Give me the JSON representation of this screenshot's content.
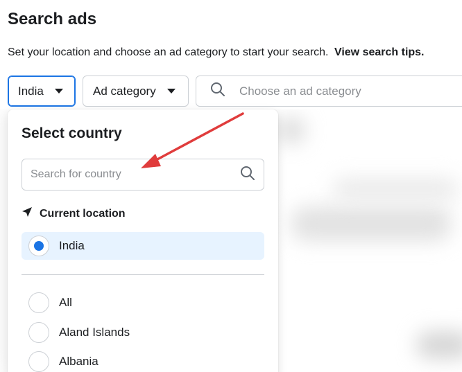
{
  "header": {
    "title": "Search ads",
    "subtitle": "Set your location and choose an ad category to start your search.",
    "tips_link": "View search tips."
  },
  "toolbar": {
    "country_label": "India",
    "category_label": "Ad category",
    "search_placeholder": "Choose an ad category"
  },
  "dropdown": {
    "title": "Select country",
    "search_placeholder": "Search for country",
    "current_location_label": "Current location",
    "selected_country": "India",
    "countries": [
      {
        "label": "All"
      },
      {
        "label": "Aland Islands"
      },
      {
        "label": "Albania"
      }
    ]
  },
  "colors": {
    "accent": "#1b74e4",
    "selected_bg": "#e7f3ff",
    "annotation_arrow": "#e03c3c"
  }
}
